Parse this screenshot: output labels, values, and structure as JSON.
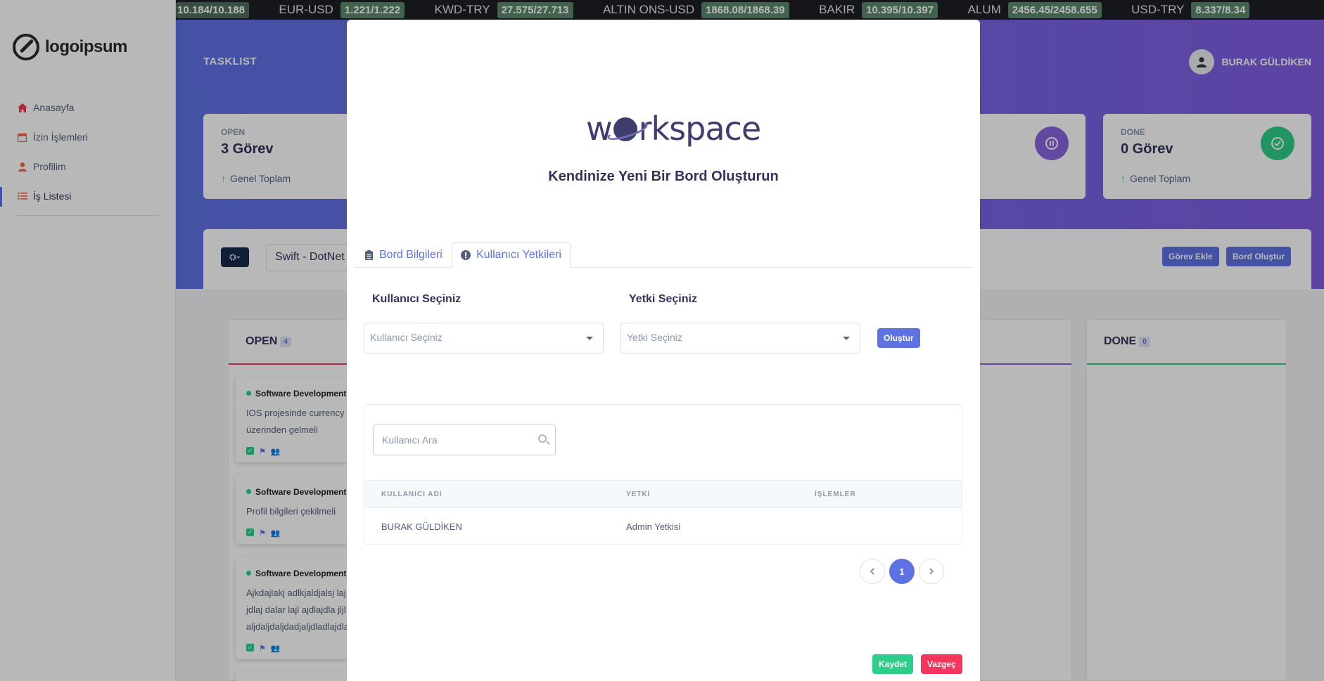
{
  "ticker": [
    {
      "name": "",
      "value": "10.184/10.188"
    },
    {
      "name": "EUR-USD",
      "value": "1.221/1.222"
    },
    {
      "name": "KWD-TRY",
      "value": "27.575/27.713"
    },
    {
      "name": "ALTIN ONS-USD",
      "value": "1868.08/1868.39"
    },
    {
      "name": "BAKIR",
      "value": "10.395/10.397"
    },
    {
      "name": "ALUM",
      "value": "2456.45/2458.655"
    },
    {
      "name": "USD-TRY",
      "value": "8.337/8.34"
    }
  ],
  "sidebar": {
    "logo_text": "logoipsum",
    "items": [
      {
        "label": "Anasayfa",
        "icon": "home-icon",
        "color": "#f5365c"
      },
      {
        "label": "İzin İşlemleri",
        "icon": "calendar-icon",
        "color": "#fb6340"
      },
      {
        "label": "Profilim",
        "icon": "user-icon",
        "color": "#fb6340"
      },
      {
        "label": "İş Listesi",
        "icon": "tasks-icon",
        "color": "#fb6340"
      }
    ]
  },
  "header": {
    "title": "TASKLIST",
    "user_name": "BURAK GÜLDİKEN"
  },
  "stats": [
    {
      "label": "OPEN",
      "value": "3 Görev",
      "foot": "Genel Toplam"
    },
    {
      "label": "DONE",
      "value": "0 Görev",
      "foot": "Genel Toplam"
    }
  ],
  "board": {
    "selected_board": "Swift - DotNet",
    "add_task_label": "Görev Ekle",
    "create_board_label": "Bord Oluştur",
    "columns": [
      {
        "title": "OPEN",
        "count": "4",
        "color": "#f5365c"
      },
      {
        "title": "DONE",
        "count": "0",
        "color": "#2dce89"
      }
    ],
    "tasks": [
      {
        "title": "Software Development",
        "desc": "IOS projesinde currency\nüzerinden gelmeli"
      },
      {
        "title": "Software Development",
        "desc": "Profil bilgileri çekilmeli"
      },
      {
        "title": "Software Development",
        "desc": "Ajkdajlakj adlkjaldjalsj laj\njdlaj dalar lajl ajdlajdla jljl\naljdaljdaljdadjaljdladlajdla"
      }
    ]
  },
  "modal": {
    "logo_left": "w",
    "logo_right": "rkspace",
    "heading": "Kendinize Yeni Bir Bord Oluşturun",
    "tabs": [
      {
        "label": "Bord Bilgileri",
        "active": false
      },
      {
        "label": "Kullanıcı Yetkileri",
        "active": true
      }
    ],
    "user_label": "Kullanıcı Seçiniz",
    "user_placeholder": "Kullanıcı Seçiniz",
    "role_label": "Yetki Seçiniz",
    "role_placeholder": "Yetki Seçiniz",
    "create_label": "Oluştur",
    "search_placeholder": "Kullanıcı Ara",
    "table": {
      "headers": [
        "KULLANICI ADI",
        "YETKİ",
        "İŞLEMLER"
      ],
      "rows": [
        {
          "user": "BURAK GÜLDİKEN",
          "role": "Admin Yetkisi",
          "actions": ""
        }
      ]
    },
    "pagination": {
      "current": "1"
    },
    "save_label": "Kaydet",
    "cancel_label": "Vazgeç"
  }
}
